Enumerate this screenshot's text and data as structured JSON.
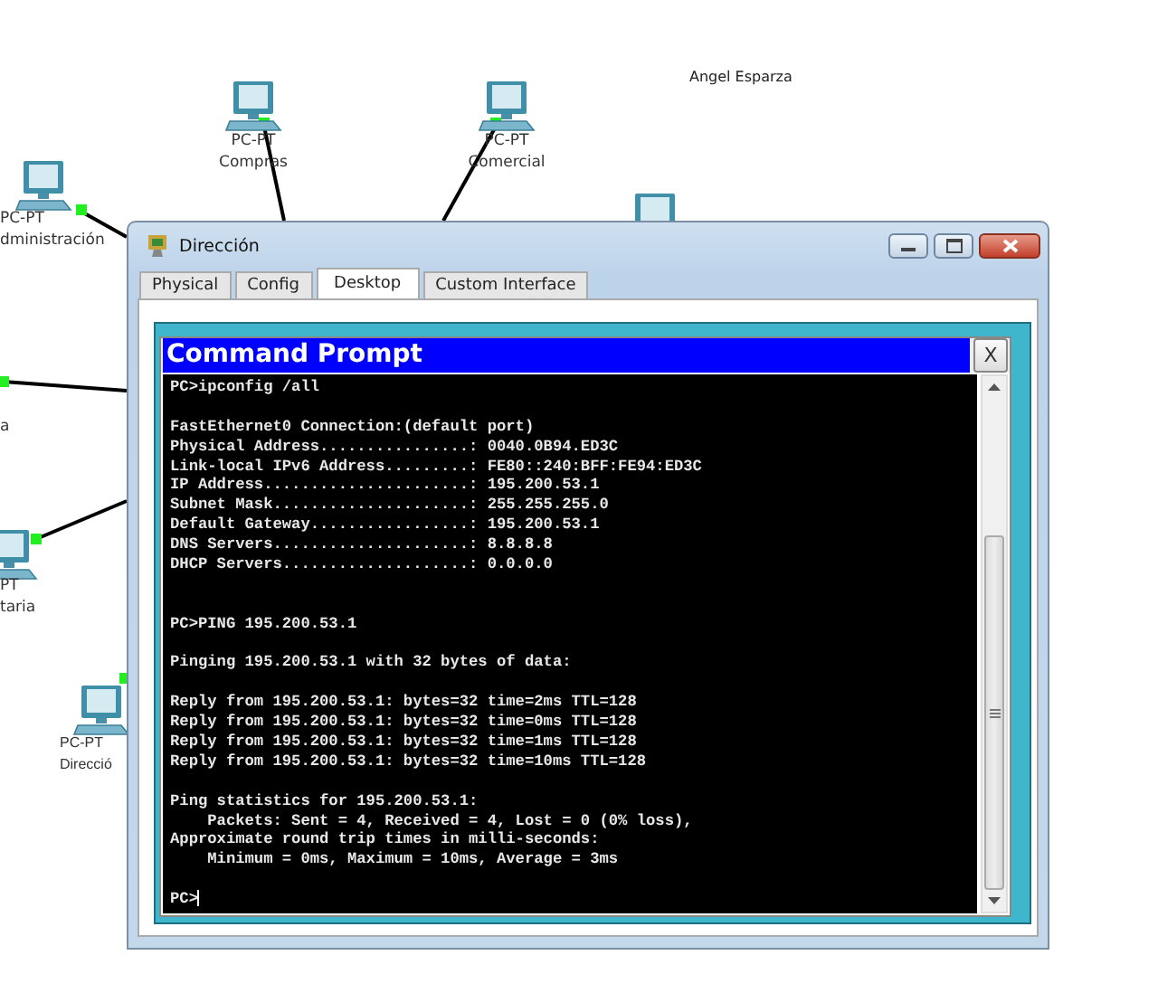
{
  "canvas": {
    "author_label": "Angel Esparza",
    "devices": [
      {
        "kind": "pc",
        "type": "PC-PT",
        "name": "Compras"
      },
      {
        "kind": "pc",
        "type": "PC-PT",
        "name": "Comercial"
      },
      {
        "kind": "pc",
        "type": "PC-PT",
        "name": "dministración"
      },
      {
        "kind": "label",
        "name": "a"
      },
      {
        "kind": "pc",
        "type": "PT",
        "name": "taria"
      },
      {
        "kind": "pc",
        "type": "PC-PT",
        "name": "Direcció"
      },
      {
        "kind": "pc"
      }
    ]
  },
  "window": {
    "title": "Dirección",
    "tabs": [
      {
        "label": "Physical",
        "selected": false
      },
      {
        "label": "Config",
        "selected": false
      },
      {
        "label": "Desktop",
        "selected": true
      },
      {
        "label": "Custom Interface",
        "selected": false
      }
    ],
    "command_prompt": {
      "title": "Command Prompt",
      "close": "X",
      "lines": [
        {
          "kind": "text",
          "text": "PC>ipconfig /all"
        },
        {
          "kind": "blank"
        },
        {
          "kind": "text",
          "text": "FastEthernet0 Connection:(default port)"
        },
        {
          "kind": "text",
          "text": "Physical Address................: 0040.0B94.ED3C"
        },
        {
          "kind": "text",
          "text": "Link-local IPv6 Address.........: FE80::240:BFF:FE94:ED3C"
        },
        {
          "kind": "text",
          "text": "IP Address......................: 195.200.53.1"
        },
        {
          "kind": "text",
          "text": "Subnet Mask.....................: 255.255.255.0"
        },
        {
          "kind": "text",
          "text": "Default Gateway.................: 195.200.53.1"
        },
        {
          "kind": "text",
          "text": "DNS Servers.....................: 8.8.8.8"
        },
        {
          "kind": "text",
          "text": "DHCP Servers....................: 0.0.0.0"
        },
        {
          "kind": "blank"
        },
        {
          "kind": "blank"
        },
        {
          "kind": "text",
          "text": "PC>PING 195.200.53.1"
        },
        {
          "kind": "blank"
        },
        {
          "kind": "text",
          "text": "Pinging 195.200.53.1 with 32 bytes of data:"
        },
        {
          "kind": "blank"
        },
        {
          "kind": "text",
          "text": "Reply from 195.200.53.1: bytes=32 time=2ms TTL=128"
        },
        {
          "kind": "text",
          "text": "Reply from 195.200.53.1: bytes=32 time=0ms TTL=128"
        },
        {
          "kind": "text",
          "text": "Reply from 195.200.53.1: bytes=32 time=1ms TTL=128"
        },
        {
          "kind": "text",
          "text": "Reply from 195.200.53.1: bytes=32 time=10ms TTL=128"
        },
        {
          "kind": "blank"
        },
        {
          "kind": "text",
          "text": "Ping statistics for 195.200.53.1:"
        },
        {
          "kind": "text",
          "text": "    Packets: Sent = 4, Received = 4, Lost = 0 (0% loss),"
        },
        {
          "kind": "text",
          "text": "Approximate round trip times in milli-seconds:"
        },
        {
          "kind": "text",
          "text": "    Minimum = 0ms, Maximum = 10ms, Average = 3ms"
        },
        {
          "kind": "blank"
        },
        {
          "kind": "prompt",
          "text": "PC>"
        }
      ]
    }
  }
}
